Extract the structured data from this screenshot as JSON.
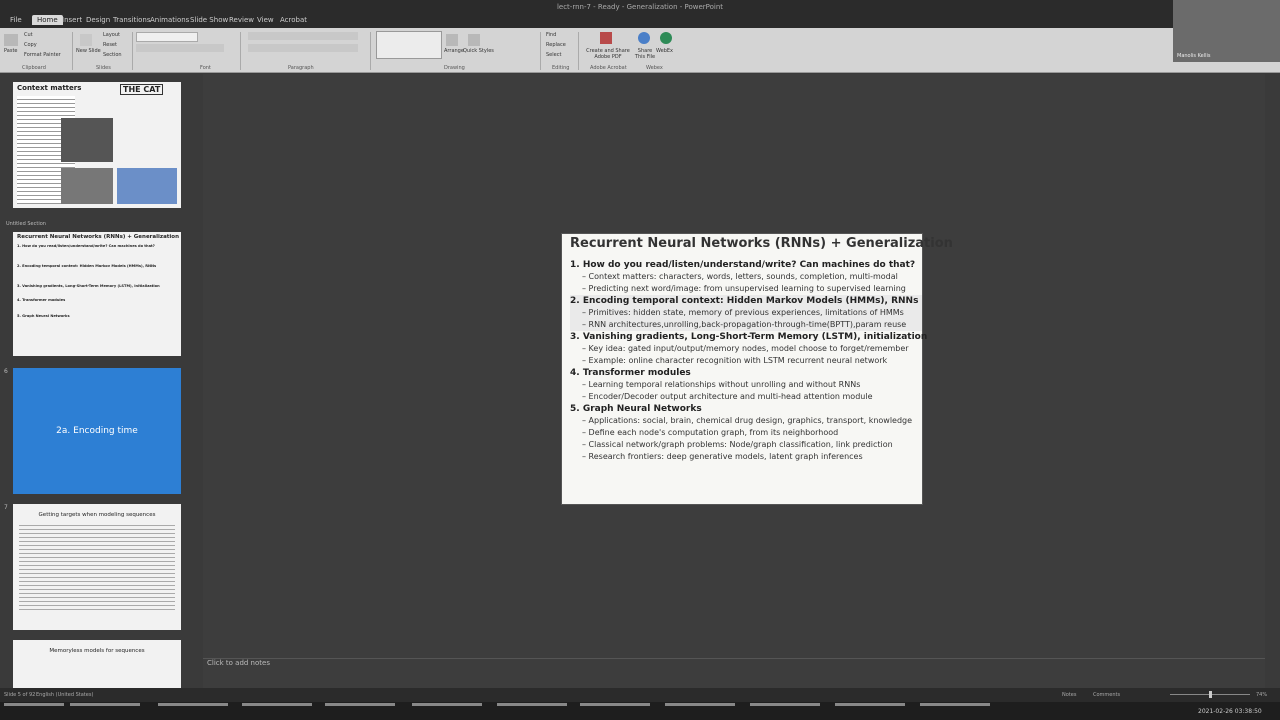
{
  "app": {
    "window_title": "lect-rnn-7 - Ready - Generalization - PowerPoint"
  },
  "menu": {
    "tabs": [
      "File",
      "Home",
      "Insert",
      "Design",
      "Transitions",
      "Animations",
      "Slide Show",
      "Review",
      "View",
      "Acrobat"
    ],
    "active": "Home"
  },
  "ribbon": {
    "clipboard": {
      "paste": "Paste",
      "cut": "Cut",
      "copy": "Copy",
      "format_painter": "Format Painter",
      "group": "Clipboard"
    },
    "slides": {
      "new_slide": "New Slide",
      "layout": "Layout",
      "reset": "Reset",
      "section": "Section",
      "group": "Slides"
    },
    "font": {
      "group": "Font"
    },
    "paragraph": {
      "group": "Paragraph"
    },
    "drawing": {
      "arrange": "Arrange",
      "quick_styles": "Quick Styles",
      "group": "Drawing"
    },
    "editing": {
      "find": "Find",
      "replace": "Replace",
      "select": "Select",
      "group": "Editing"
    },
    "adobe": {
      "create": "Create and Share Adobe PDF",
      "group": "Adobe Acrobat"
    },
    "share": {
      "share": "Share This File",
      "webex": "WebEx",
      "group": "Webex"
    }
  },
  "webcam": {
    "label": "Manolis Kellis"
  },
  "thumbnails": {
    "slide1": {
      "title": "Context matters",
      "image_caption": "THE CAT"
    },
    "section_label": "Untitled Section",
    "slide2": {
      "title": "Recurrent Neural Networks (RNNs) + Generalization",
      "lines": [
        "1. How do you read/listen/understand/write? Can machines do that?",
        "2. Encoding temporal context: Hidden Markov Models (HMMs), RNNs",
        "3. Vanishing gradients, Long-Short-Term Memory (LSTM), initialization",
        "4. Transformer modules",
        "5. Graph Neural Networks"
      ]
    },
    "slide3": {
      "number": "6",
      "title": "2a. Encoding time"
    },
    "slide4": {
      "number": "7",
      "title": "Getting targets when modeling sequences"
    },
    "slide5": {
      "title": "Memoryless models for sequences"
    }
  },
  "slide": {
    "title": "Recurrent Neural Networks (RNNs) + Generalization",
    "items": [
      {
        "heading": "1. How do you read/listen/understand/write? Can machines do that?",
        "bullets": [
          "– Context matters: characters, words, letters, sounds, completion, multi-modal",
          "– Predicting next word/image: from unsupervised learning to supervised learning"
        ]
      },
      {
        "heading": "2. Encoding temporal context: Hidden Markov Models (HMMs), RNNs",
        "bullets": [
          "– Primitives: hidden state, memory of previous experiences, limitations of HMMs",
          "– RNN architectures,unrolling,back-propagation-through-time(BPTT),param reuse"
        ]
      },
      {
        "heading": "3. Vanishing gradients, Long-Short-Term Memory (LSTM), initialization",
        "bullets": [
          "– Key idea: gated input/output/memory nodes, model choose to forget/remember",
          "– Example: online character recognition with LSTM recurrent neural network"
        ]
      },
      {
        "heading": "4. Transformer modules",
        "bullets": [
          "– Learning temporal relationships without unrolling and without RNNs",
          "– Encoder/Decoder output architecture and multi-head attention module"
        ]
      },
      {
        "heading": "5. Graph Neural Networks",
        "bullets": [
          "– Applications: social, brain, chemical drug design, graphics, transport, knowledge",
          "– Define each node's computation graph, from its neighborhood",
          "– Classical network/graph problems: Node/graph classification, link prediction",
          "– Research frontiers: deep generative models, latent graph inferences"
        ]
      }
    ]
  },
  "notes": {
    "placeholder": "Click to add notes"
  },
  "status": {
    "slide_info": "Slide 5 of 92",
    "language": "English (United States)",
    "notes": "Notes",
    "comments": "Comments",
    "zoom": "74%"
  },
  "taskbar": {
    "datetime": "2021-02-26 03:38:50"
  }
}
